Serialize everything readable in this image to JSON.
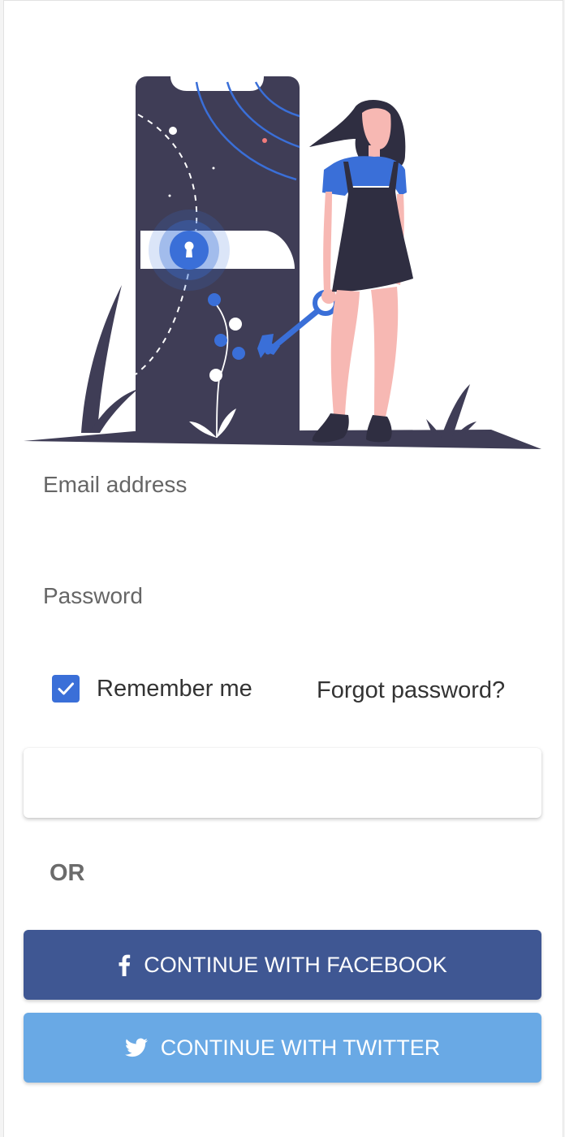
{
  "form": {
    "email_label": "Email address",
    "email_value": "",
    "password_label": "Password",
    "password_value": "",
    "remember_label": "Remember me",
    "remember_checked": true,
    "forgot_label": "Forgot password?",
    "primary_button_label": ""
  },
  "divider": {
    "or_label": "OR"
  },
  "social": {
    "facebook_label": "CONTINUE WITH FACEBOOK",
    "twitter_label": "CONTINUE WITH TWITTER"
  },
  "colors": {
    "accent": "#3a6fd8",
    "facebook": "#3f5793",
    "twitter": "#69a9e5",
    "illustration_dark": "#3f3d56",
    "skin": "#f7b8b3"
  },
  "icons": {
    "checkbox": "check-icon",
    "facebook": "facebook-icon",
    "twitter": "twitter-icon"
  }
}
